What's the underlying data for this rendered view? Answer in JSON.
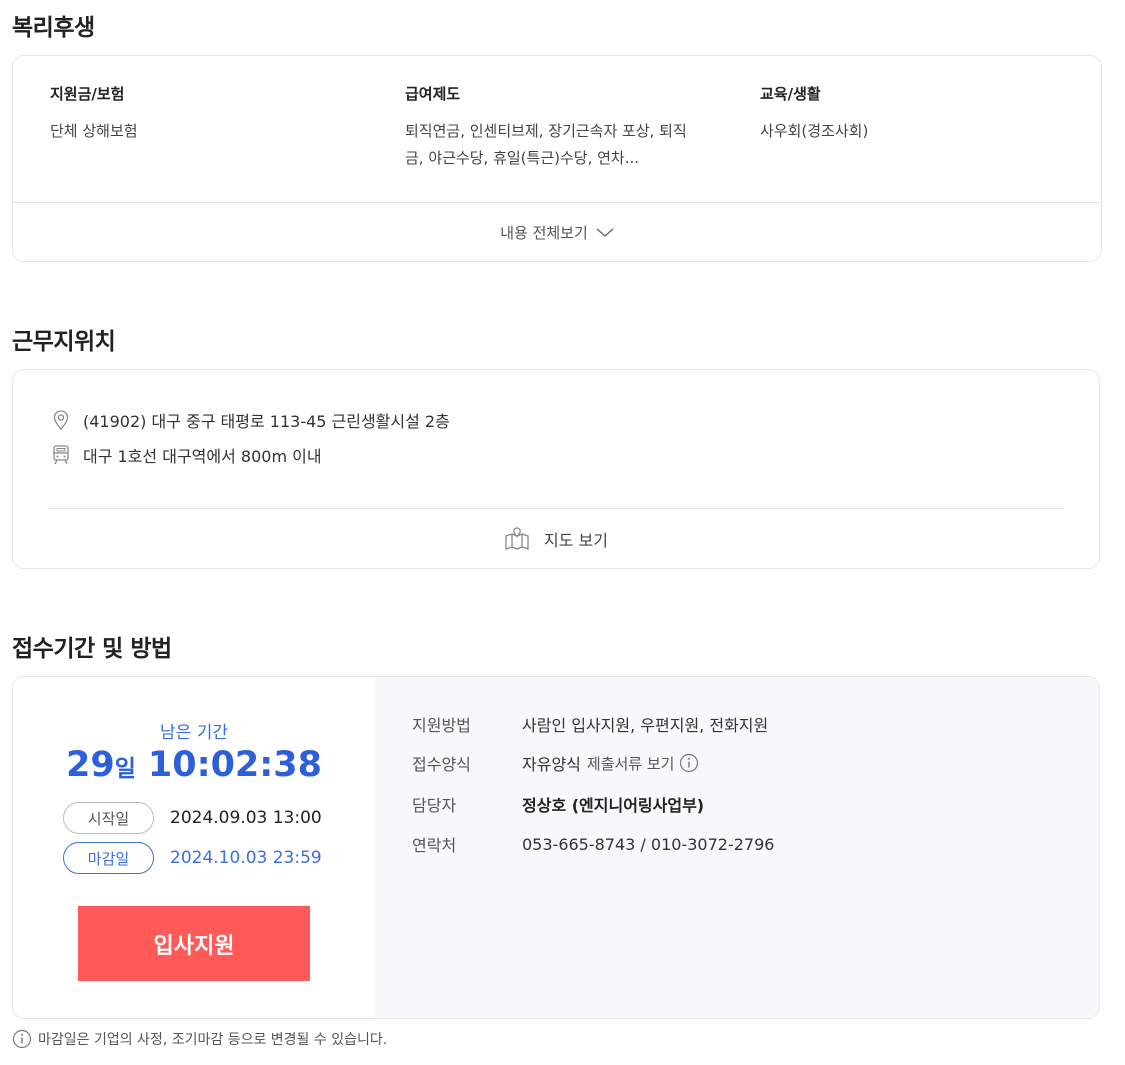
{
  "welfare": {
    "title": "복리후생",
    "columns": [
      {
        "title": "지원금/보험",
        "desc_lines": [
          "단체 상해보험"
        ]
      },
      {
        "title": "급여제도",
        "desc_lines": [
          "퇴직연금, 인센티브제, 장기근속자 포상, 퇴직",
          "금, 야근수당, 휴일(특근)수당, 연차..."
        ]
      },
      {
        "title": "교육/생활",
        "desc_lines": [
          "사우회(경조사회)"
        ]
      }
    ],
    "expand_label": "내용 전체보기",
    "expand_icon": "chevron-down-icon"
  },
  "location": {
    "title": "근무지위치",
    "address": "(41902) 대구 중구 태평로 113-45 근린생활시설 2층",
    "address_icon": "location-pin-icon",
    "subway": "대구 1호선 대구역에서 800m 이내",
    "subway_icon": "train-icon",
    "map_label": "지도 보기",
    "map_icon": "map-icon"
  },
  "apply": {
    "title": "접수기간 및 방법",
    "remain_label": "남은 기간",
    "remain_days": "29",
    "remain_days_unit": "일",
    "remain_time": "10:02:38",
    "start_label": "시작일",
    "start_date": "2024.09.03 13:00",
    "end_label": "마감일",
    "end_date": "2024.10.03 23:59",
    "apply_button": "입사지원",
    "info": {
      "method_label": "지원방법",
      "method_value": "사람인 입사지원, 우편지원, 전화지원",
      "form_label": "접수양식",
      "form_value": "자유양식",
      "form_link": "제출서류 보기",
      "manager_label": "담당자",
      "manager_value": "정상호 (엔지니어링사업부)",
      "contact_label": "연락처",
      "contact_value": "053-665-8743 / 010-3072-2796"
    },
    "notice": "마감일은 기업의 사정, 조기마감 등으로 변경될 수 있습니다."
  },
  "colors": {
    "accent_blue": "#3b6fe0",
    "apply_red": "#ff5a57",
    "panel_gray": "#f7f8fa"
  }
}
